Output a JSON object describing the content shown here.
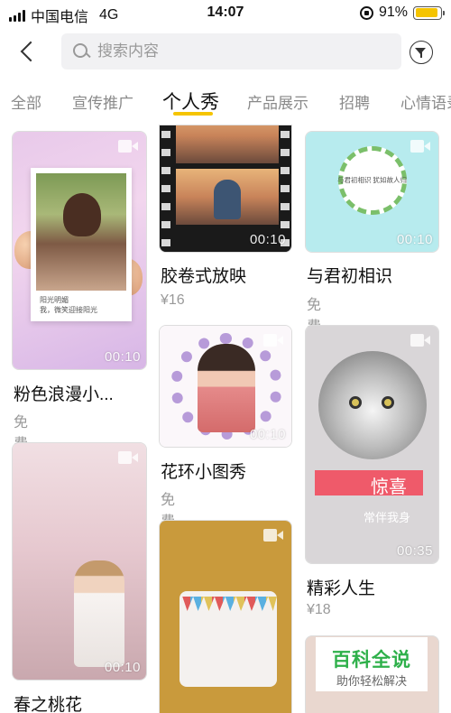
{
  "status_bar": {
    "carrier": "中国电信",
    "network": "4G",
    "time": "14:07",
    "battery": "91%",
    "battery_level": 0.91
  },
  "search": {
    "placeholder": "搜索内容"
  },
  "tabs": [
    {
      "label": "全部",
      "active": false
    },
    {
      "label": "宣传推广",
      "active": false
    },
    {
      "label": "个人秀",
      "active": true
    },
    {
      "label": "产品展示",
      "active": false
    },
    {
      "label": "招聘",
      "active": false
    },
    {
      "label": "心情语录",
      "active": false
    }
  ],
  "cards": [
    {
      "title": "粉色浪漫小...",
      "price": "免费",
      "duration": "00:10",
      "thumb_text": "阳光明媚\n我，微笑迎接阳光"
    },
    {
      "title": "胶卷式放映",
      "price": "¥16",
      "duration": "00:10"
    },
    {
      "title": "与君初相识",
      "price": "免费",
      "duration": "00:10",
      "thumb_text": "与君初相识\n犹如故人归"
    },
    {
      "title": "花环小图秀",
      "price": "免费",
      "duration": "00:10"
    },
    {
      "title": "精彩人生",
      "price": "¥18",
      "duration": "00:35",
      "thumb_text": "惊喜",
      "thumb_subtext": "常伴我身"
    },
    {
      "title": "春之桃花",
      "price": "",
      "duration": "00:10"
    },
    {
      "title": "",
      "price": "",
      "duration": ""
    }
  ],
  "watermark": {
    "title": "百科全说",
    "subtitle": "助你轻松解决"
  },
  "colors": {
    "accent": "#f5c400",
    "watermark_green": "#2eb04a"
  }
}
